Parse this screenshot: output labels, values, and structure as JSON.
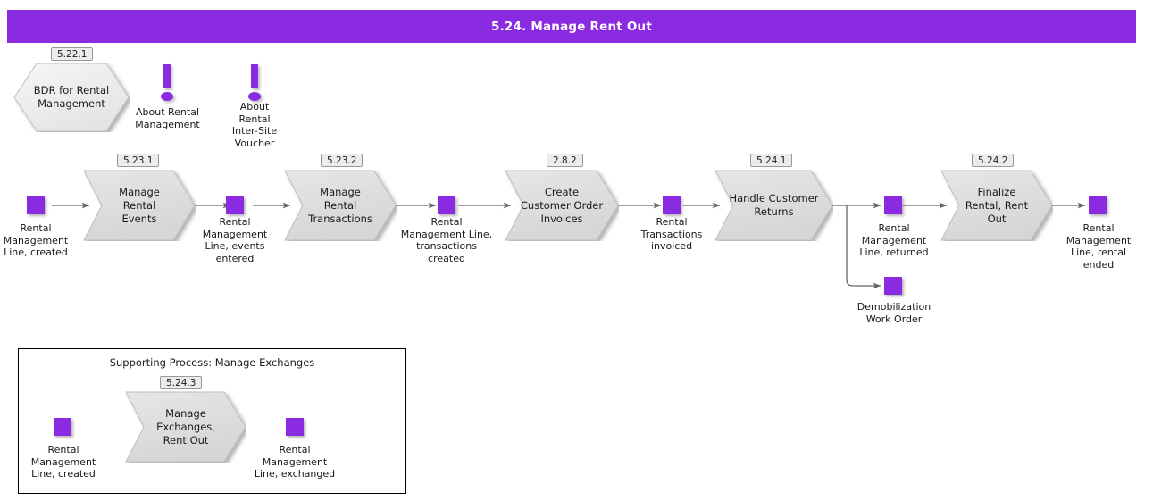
{
  "header": {
    "title": "5.24. Manage Rent Out",
    "bar_color": "#8A2BE2"
  },
  "theme": {
    "accent": "#8A2BE2",
    "shape_fill": "#DCDCDC",
    "shape_stroke": "#A0A0A0",
    "hexagon_fill": "#EFEFEF",
    "tag_fill": "#ECECEC",
    "tag_border": "#999999",
    "connector": "#666666",
    "frame_border": "#000000"
  },
  "top_row": {
    "hexagon": {
      "tag": "5.22.1",
      "label": "BDR for Rental\nManagement"
    },
    "notes": [
      {
        "name": "about-rental-management",
        "label": "About Rental\nManagement"
      },
      {
        "name": "about-rental-inter-site-voucher",
        "label": "About\nRental\nInter-Site\nVoucher"
      }
    ]
  },
  "main_flow": {
    "processes": [
      {
        "tag": "5.23.1",
        "label": "Manage Rental\nEvents"
      },
      {
        "tag": "5.23.2",
        "label": "Manage Rental\nTransactions"
      },
      {
        "tag": "2.8.2",
        "label": "Create\nCustomer Order\nInvoices"
      },
      {
        "tag": "5.24.1",
        "label": "Handle Customer\nReturns"
      },
      {
        "tag": "5.24.2",
        "label": "Finalize\nRental, Rent\nOut"
      }
    ],
    "objects": [
      {
        "name": "rental-management-line-created",
        "label": "Rental\nManagement\nLine, created"
      },
      {
        "name": "rental-management-line-events-entered",
        "label": "Rental\nManagement\nLine, events\nentered"
      },
      {
        "name": "rental-management-line-transactions-created",
        "label": "Rental\nManagement Line,\ntransactions\ncreated"
      },
      {
        "name": "rental-transactions-invoiced",
        "label": "Rental\nTransactions\ninvoiced"
      },
      {
        "name": "rental-management-line-returned",
        "label": "Rental\nManagement\nLine, returned"
      },
      {
        "name": "demobilization-work-order",
        "label": "Demobilization\nWork Order"
      },
      {
        "name": "rental-management-line-rental-ended",
        "label": "Rental\nManagement\nLine, rental\nended"
      }
    ]
  },
  "supporting_process": {
    "title": "Supporting Process: Manage Exchanges",
    "process": {
      "tag": "5.24.3",
      "label": "Manage\nExchanges,\nRent Out"
    },
    "objects": [
      {
        "name": "sub-rental-management-line-created",
        "label": "Rental\nManagement\nLine, created"
      },
      {
        "name": "sub-rental-management-line-exchanged",
        "label": "Rental\nManagement\nLine, exchanged"
      }
    ]
  }
}
